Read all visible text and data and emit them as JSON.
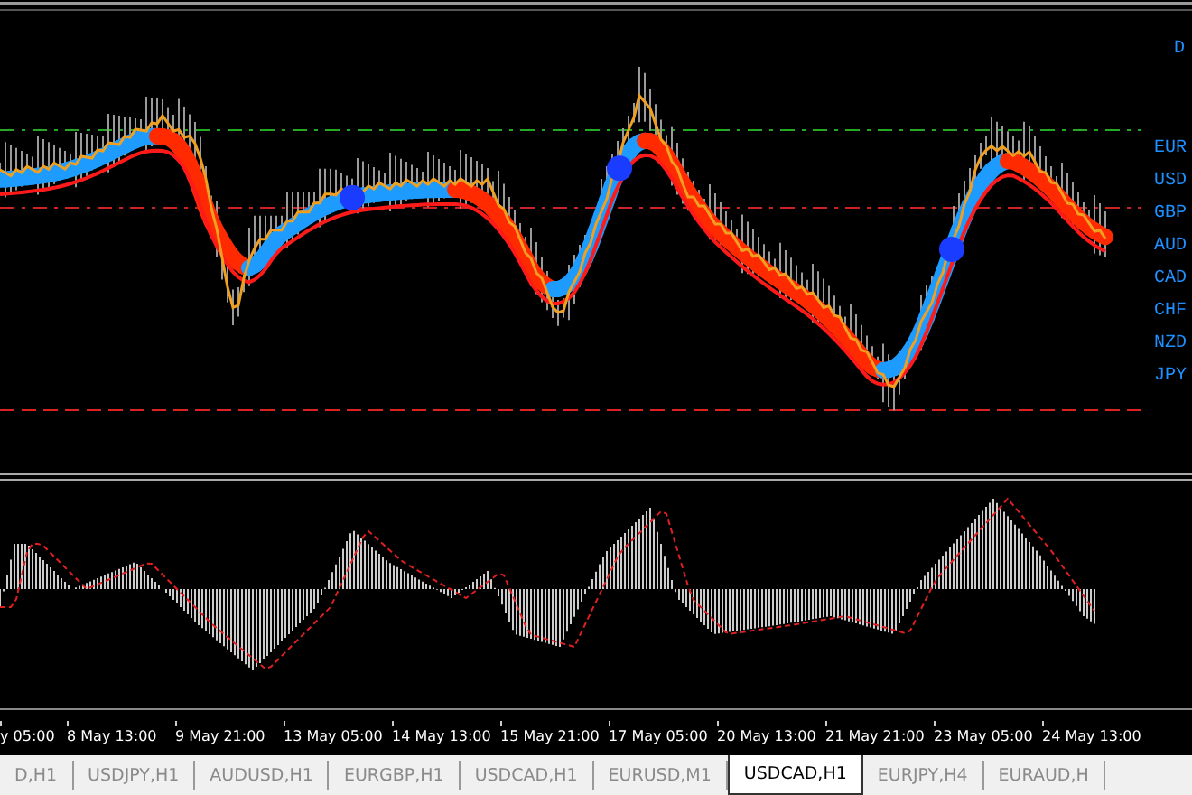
{
  "chart": {
    "corner_label": "D",
    "currency_labels": [
      "EUR",
      "USD",
      "GBP",
      "AUD",
      "CAD",
      "CHF",
      "NZD",
      "JPY"
    ]
  },
  "time_axis": {
    "labels": [
      "y 05:00",
      "8 May 13:00",
      "9 May 21:00",
      "13 May 05:00",
      "14 May 13:00",
      "15 May 21:00",
      "17 May 05:00",
      "20 May 13:00",
      "21 May 21:00",
      "23 May 05:00",
      "24 May 13:00"
    ]
  },
  "tabs": [
    {
      "label": "D,H1",
      "selected": false
    },
    {
      "label": "USDJPY,H1",
      "selected": false
    },
    {
      "label": "AUDUSD,H1",
      "selected": false
    },
    {
      "label": "EURGBP,H1",
      "selected": false
    },
    {
      "label": "USDCAD,H1",
      "selected": false
    },
    {
      "label": "EURUSD,M1",
      "selected": false
    },
    {
      "label": "USDCAD,H1",
      "selected": true
    },
    {
      "label": "EURJPY,H4",
      "selected": false
    },
    {
      "label": "EURAUD,H",
      "selected": false
    }
  ]
}
